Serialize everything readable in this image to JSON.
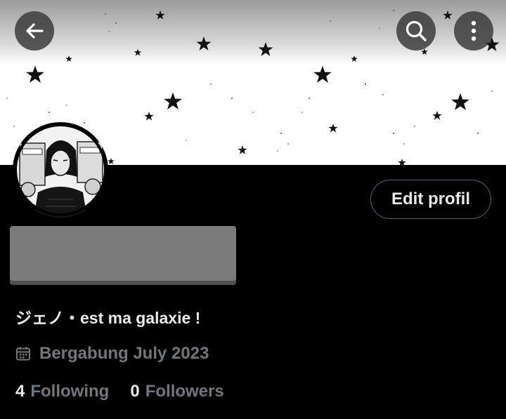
{
  "header": {
    "back_icon": "arrow-left-icon",
    "search_icon": "search-icon",
    "more_icon": "more-vertical-icon"
  },
  "profile": {
    "banner_description": "",
    "edit_button_label": "Edit profil",
    "bio": "ジェノ・est ma galaxie !",
    "joined_text": "Bergabung July 2023",
    "joined_icon": "calendar-icon",
    "following_count": "4",
    "following_label": "Following",
    "followers_count": "0",
    "followers_label": "Followers"
  },
  "colors": {
    "background": "#000000",
    "primary_text": "#e7e9ea",
    "secondary_text": "#71767b",
    "button_border": "#536471"
  }
}
